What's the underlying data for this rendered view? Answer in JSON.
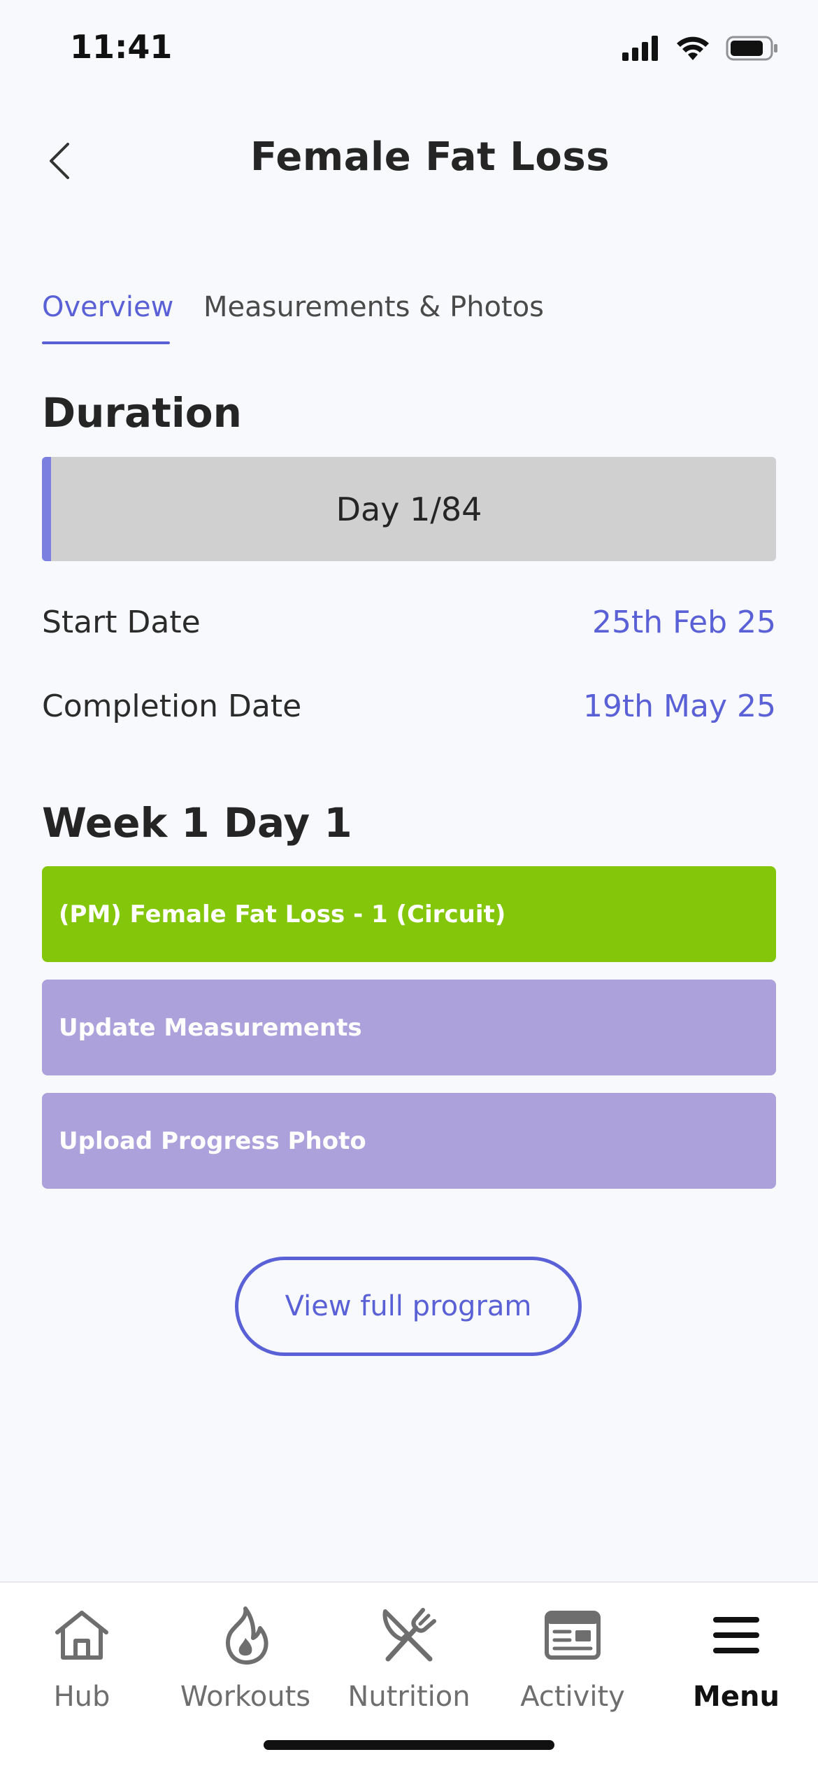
{
  "status_bar": {
    "time": "11:41"
  },
  "header": {
    "title": "Female Fat Loss"
  },
  "tabs": [
    {
      "label": "Overview",
      "active": true
    },
    {
      "label": "Measurements & Photos",
      "active": false
    }
  ],
  "duration": {
    "title": "Duration",
    "progress_label": "Day 1/84",
    "progress_fraction": 0.012,
    "start_label": "Start Date",
    "start_value": "25th Feb 25",
    "completion_label": "Completion Date",
    "completion_value": "19th May 25"
  },
  "week": {
    "title": "Week 1 Day 1",
    "tasks": [
      {
        "label": "(PM) Female Fat Loss - 1 (Circuit)",
        "color": "#84c70a"
      },
      {
        "label": "Update Measurements",
        "color": "#ada1dc"
      },
      {
        "label": "Upload Progress Photo",
        "color": "#ada1dc"
      }
    ]
  },
  "view_program_label": "View full program",
  "bottom_nav": [
    {
      "label": "Hub",
      "icon": "home-icon",
      "active": false
    },
    {
      "label": "Workouts",
      "icon": "flame-icon",
      "active": false
    },
    {
      "label": "Nutrition",
      "icon": "fork-knife-icon",
      "active": false
    },
    {
      "label": "Activity",
      "icon": "newspaper-icon",
      "active": false
    },
    {
      "label": "Menu",
      "icon": "hamburger-icon",
      "active": true
    }
  ],
  "colors": {
    "accent": "#5a60d6",
    "workout_green": "#84c70a",
    "task_purple": "#ada1dc",
    "background": "#f8f9fd"
  }
}
